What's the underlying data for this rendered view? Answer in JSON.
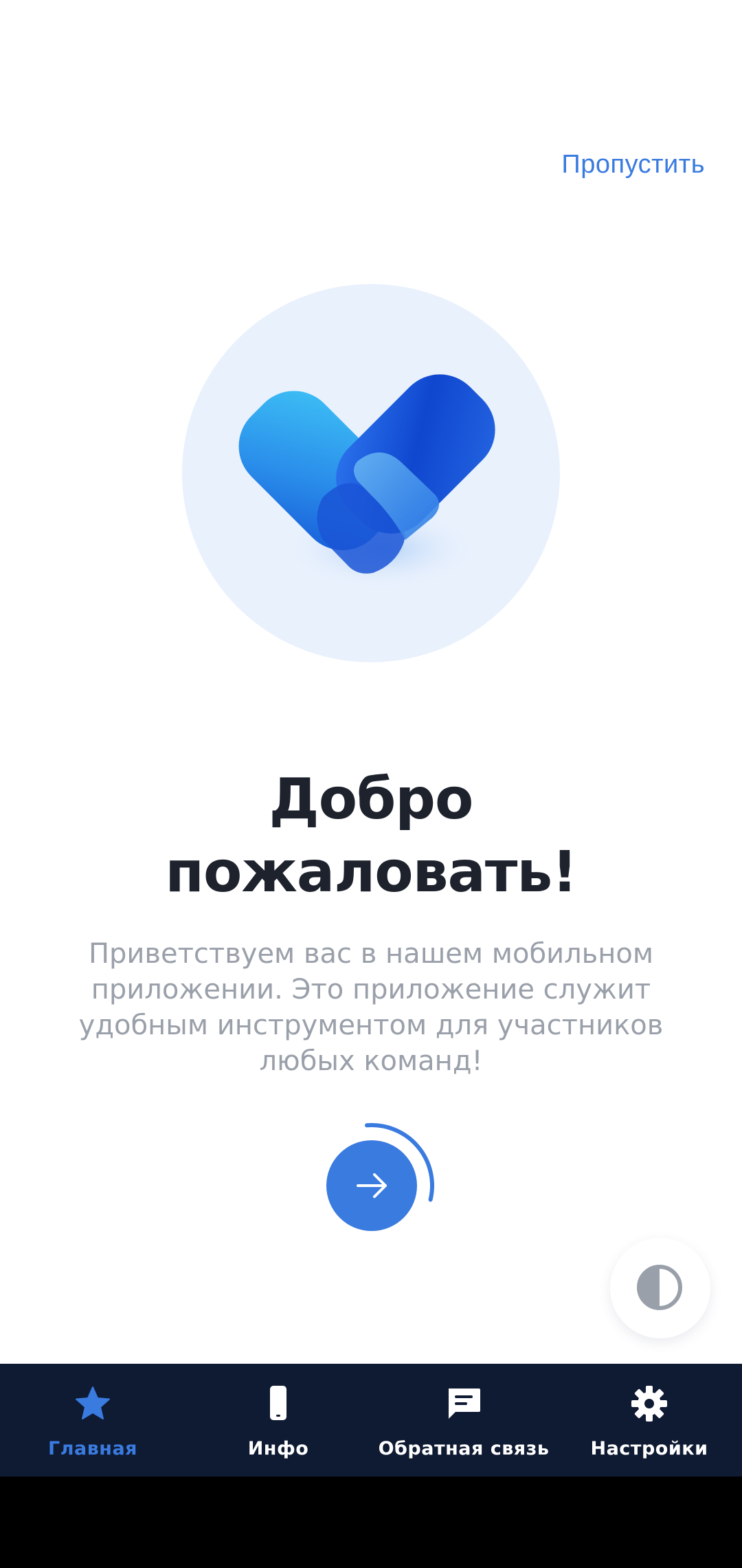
{
  "header": {
    "skip_label": "Пропустить"
  },
  "onboarding": {
    "title_line1": "Добро",
    "title_line2": "пожаловать!",
    "description": "Приветствуем вас в нашем мобильном\nприложении.  Это приложение служит\nудобным инструментом для участников\nлюбых команд!",
    "next_icon": "arrow-right-icon",
    "progress": 0.25
  },
  "theme_toggle": {
    "icon": "contrast-icon"
  },
  "bottom_nav": {
    "items": [
      {
        "label": "Главная",
        "icon": "star-icon",
        "active": true
      },
      {
        "label": "Инфо",
        "icon": "phone-icon",
        "active": false
      },
      {
        "label": "Обратная связь",
        "icon": "chat-icon",
        "active": false
      },
      {
        "label": "Настройки",
        "icon": "gear-icon",
        "active": false
      }
    ]
  },
  "colors": {
    "accent": "#3a7be0",
    "nav_background": "#0f1a33",
    "title": "#1e222d",
    "subtitle": "#9aa0aa",
    "illustration_bg": "#e9f1fd"
  }
}
